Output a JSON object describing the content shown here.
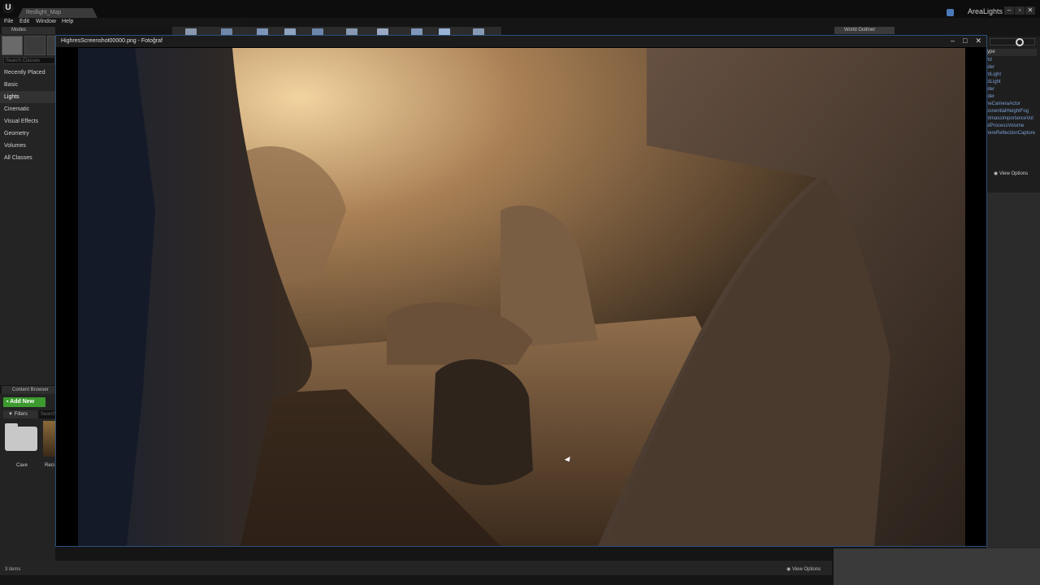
{
  "app": {
    "logo": "U",
    "document_tab": "Redlight_Map",
    "project_name": "AreaLights",
    "window_controls": [
      "–",
      "▫",
      "✕"
    ]
  },
  "menu": [
    "File",
    "Edit",
    "Window",
    "Help"
  ],
  "modes": {
    "tab_label": "Modes",
    "search_placeholder": "Search Classes",
    "items": [
      "Recently Placed",
      "Basic",
      "Lights",
      "Cinematic",
      "Visual Effects",
      "Geometry",
      "Volumes",
      "All Classes"
    ],
    "selected": "Lights"
  },
  "content_browser": {
    "tab_label": "Content Browser",
    "add_new": "Add New",
    "filters": "Filters",
    "search_placeholder": "Search",
    "assets": [
      "Cave",
      "Reci"
    ],
    "items_count": "3 items",
    "view_options": "View Options"
  },
  "world_outliner": {
    "tab_label": "World Outliner",
    "header": "ype",
    "rows": [
      "rld",
      "lder",
      "ntLight",
      "ctLight",
      "lder",
      "lder",
      "neCameraActor",
      "ponentialHeightFog",
      "htmassImportanceVol",
      "stProcessVolume",
      "hereReflectionCapture"
    ],
    "view_options": "View Options"
  },
  "viewer": {
    "title": "HighresScreenshot00000.png - Fotoğraf",
    "controls": [
      "–",
      "□",
      "✕"
    ]
  },
  "colors": {
    "accent_green": "#3c9a2e",
    "viewer_border": "#2d4f7c",
    "outliner_text": "#7c9fd4"
  }
}
